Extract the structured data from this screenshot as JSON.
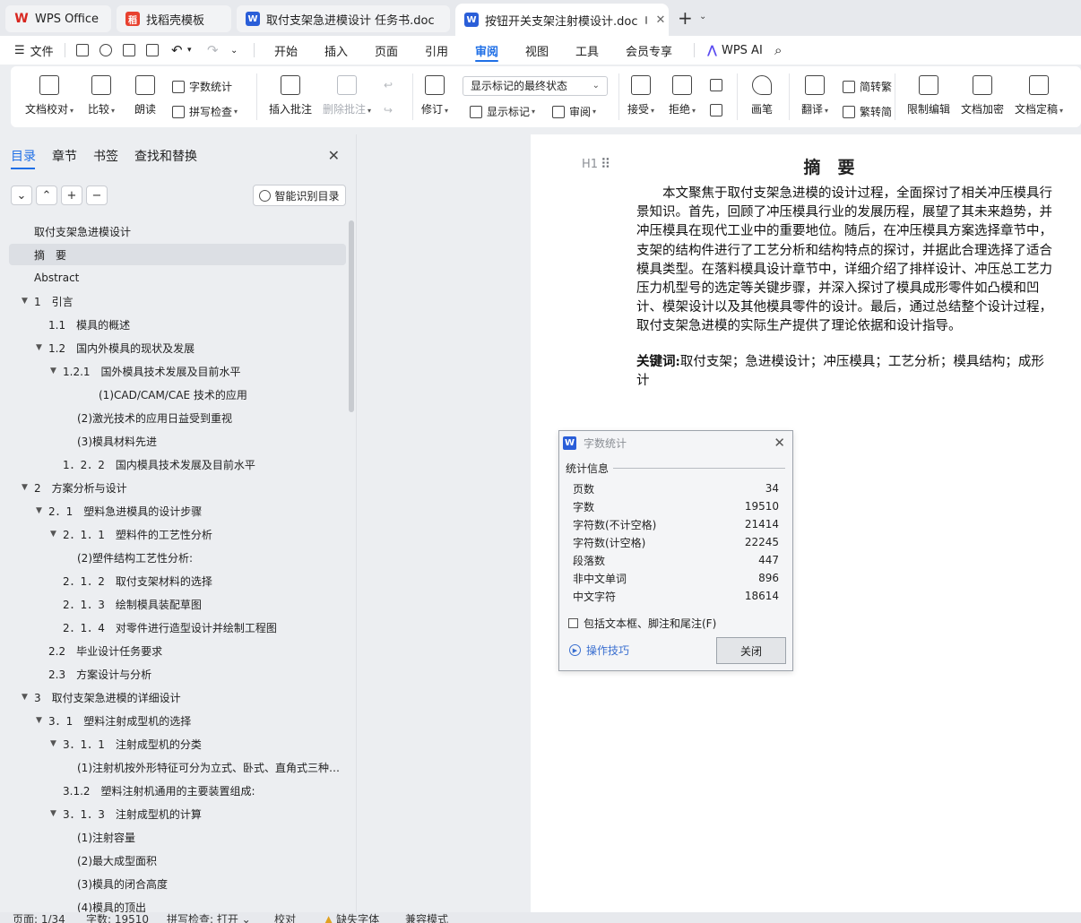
{
  "tabs": [
    {
      "label": "WPS Office",
      "icon": "wps-logo-icon"
    },
    {
      "label": "找稻壳模板",
      "icon": "docer-icon"
    },
    {
      "label": "取付支架急进模设计 任务书.doc",
      "icon": "word-doc-icon"
    },
    {
      "label": "按钮开关支架注射模设计.doc",
      "icon": "word-doc-icon",
      "active": true
    }
  ],
  "menu": {
    "file": "文件",
    "items": [
      "开始",
      "插入",
      "页面",
      "引用",
      "审阅",
      "视图",
      "工具",
      "会员专享"
    ],
    "active": "审阅",
    "ai": "WPS AI"
  },
  "ribbon": {
    "proofread": "文档校对",
    "compare": "比较",
    "read_aloud": "朗读",
    "word_count": "字数统计",
    "spell_check": "拼写检查",
    "insert_comment": "插入批注",
    "delete_comment": "删除批注",
    "revise": "修订",
    "display_state": "显示标记的最终状态",
    "show_markup": "显示标记",
    "review": "审阅",
    "accept": "接受",
    "reject": "拒绝",
    "pen": "画笔",
    "translate": "翻译",
    "to_traditional": "简转繁",
    "to_simplified": "繁转简",
    "restrict_edit": "限制编辑",
    "encrypt": "文档加密",
    "finalize": "文档定稿"
  },
  "nav": {
    "tabs": [
      "目录",
      "章节",
      "书签",
      "查找和替换"
    ],
    "active_tab": "目录",
    "smart_button": "智能识别目录",
    "toc": [
      {
        "text": "取付支架急进模设计",
        "level": 0,
        "caret": ""
      },
      {
        "text": "摘　要",
        "level": 0,
        "caret": "",
        "selected": true
      },
      {
        "text": "Abstract",
        "level": 0,
        "caret": ""
      },
      {
        "text": "1　引言",
        "level": 0,
        "caret": "▼"
      },
      {
        "text": "1.1　模具的概述",
        "level": 1,
        "caret": ""
      },
      {
        "text": "1.2　国内外模具的现状及发展",
        "level": 1,
        "caret": "▼"
      },
      {
        "text": "1.2.1　国外模具技术发展及目前水平",
        "level": 2,
        "caret": "▼"
      },
      {
        "text": "(1)CAD/CAM/CAE 技术的应用",
        "level": 4,
        "caret": ""
      },
      {
        "text": "(2)激光技术的应用日益受到重视",
        "level": 3,
        "caret": ""
      },
      {
        "text": "(3)模具材料先进",
        "level": 3,
        "caret": ""
      },
      {
        "text": "1．2．2　国内模具技术发展及目前水平",
        "level": 2,
        "caret": ""
      },
      {
        "text": "2　方案分析与设计",
        "level": 0,
        "caret": "▼"
      },
      {
        "text": "2．1　塑料急进模具的设计步骤",
        "level": 1,
        "caret": "▼"
      },
      {
        "text": "2．1．1　塑料件的工艺性分析",
        "level": 2,
        "caret": "▼"
      },
      {
        "text": "(2)塑件结构工艺性分析:",
        "level": 3,
        "caret": ""
      },
      {
        "text": "2．1．2　取付支架材料的选择",
        "level": 2,
        "caret": ""
      },
      {
        "text": "2．1．3　绘制模具装配草图",
        "level": 2,
        "caret": ""
      },
      {
        "text": "2．1．4　对零件进行造型设计并绘制工程图",
        "level": 2,
        "caret": ""
      },
      {
        "text": "2.2　毕业设计任务要求",
        "level": 1,
        "caret": ""
      },
      {
        "text": "2.3　方案设计与分析",
        "level": 1,
        "caret": ""
      },
      {
        "text": "3　取付支架急进模的详细设计",
        "level": 0,
        "caret": "▼"
      },
      {
        "text": "3．1　塑料注射成型机的选择",
        "level": 1,
        "caret": "▼"
      },
      {
        "text": "3．1．1　注射成型机的分类",
        "level": 2,
        "caret": "▼"
      },
      {
        "text": "(1)注射机按外形特征可分为立式、卧式、直角式三种…",
        "level": 3,
        "caret": ""
      },
      {
        "text": "3.1.2　塑料注射机通用的主要装置组成:",
        "level": 2,
        "caret": ""
      },
      {
        "text": "3．1．3　注射成型机的计算",
        "level": 2,
        "caret": "▼"
      },
      {
        "text": "(1)注射容量",
        "level": 3,
        "caret": ""
      },
      {
        "text": "(2)最大成型面积",
        "level": 3,
        "caret": ""
      },
      {
        "text": "(3)模具的闭合高度",
        "level": 3,
        "caret": ""
      },
      {
        "text": "(4)模具的顶出",
        "level": 3,
        "caret": ""
      }
    ]
  },
  "document": {
    "heading_marker": "H1",
    "title": "摘　要",
    "lines": [
      "　　本文聚焦于取付支架急进模的设计过程，全面探讨了相关冲压模具行",
      "景知识。首先，回顾了冲压模具行业的发展历程，展望了其未来趋势，并",
      "冲压模具在现代工业中的重要地位。随后，在冲压模具方案选择章节中，",
      "支架的结构件进行了工艺分析和结构特点的探讨，并据此合理选择了适合",
      "模具类型。在落料模具设计章节中，详细介绍了排样设计、冲压总工艺力",
      "压力机型号的选定等关键步骤，并深入探讨了模具成形零件如凸模和凹",
      "计、模架设计以及其他模具零件的设计。最后，通过总结整个设计过程，",
      "取付支架急进模的实际生产提供了理论依据和设计指导。"
    ],
    "keywords_label": "关键词:",
    "keywords_line1": "取付支架；急进模设计；冲压模具；工艺分析；模具结构；成形",
    "keywords_line2": "计"
  },
  "dialog": {
    "title": "字数统计",
    "section": "统计信息",
    "stats": [
      {
        "label": "页数",
        "value": "34"
      },
      {
        "label": "字数",
        "value": "19510"
      },
      {
        "label": "字符数(不计空格)",
        "value": "21414"
      },
      {
        "label": "字符数(计空格)",
        "value": "22245"
      },
      {
        "label": "段落数",
        "value": "447"
      },
      {
        "label": "非中文单词",
        "value": "896"
      },
      {
        "label": "中文字符",
        "value": "18614"
      }
    ],
    "checkbox": "包括文本框、脚注和尾注(F)",
    "tips": "操作技巧",
    "close": "关闭"
  },
  "status": {
    "page": "页面: 1/34",
    "words": "字数: 19510",
    "spell": "拼写检查: 打开",
    "proof": "校对",
    "missing_font": "缺失字体",
    "compat": "兼容模式"
  }
}
